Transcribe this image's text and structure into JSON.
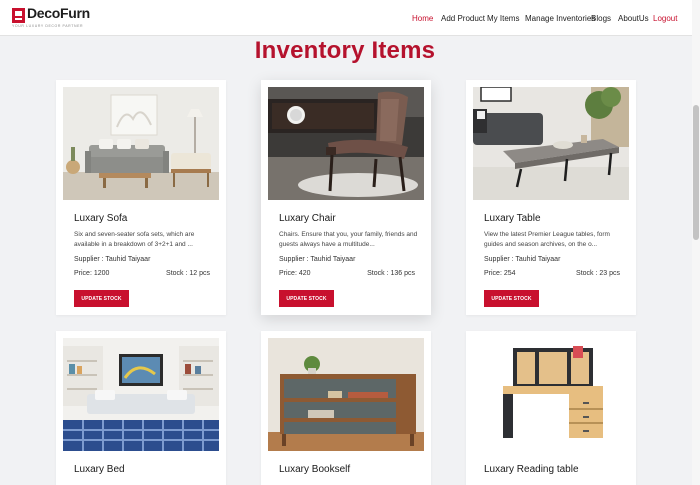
{
  "brand": {
    "name": "DecoFurn",
    "tagline": "YOUR LUXURY DECOR PARTNER"
  },
  "nav": {
    "home": "Home",
    "add_product": "Add Product",
    "my_items": "My Items",
    "manage_inventories": "Manage Inventories",
    "blogs": "Blogs",
    "about": "AboutUs",
    "logout": "Logout"
  },
  "page": {
    "title": "Inventory Items"
  },
  "labels": {
    "update_stock": "UPDATE STOCK"
  },
  "items": [
    {
      "name": "Luxary Sofa",
      "description": "Six and seven-seater sofa sets, which are available in a breakdown of 3+2+1 and ...",
      "supplier": "Supplier : Tauhid Taiyaar",
      "price": "Price: 1200",
      "stock": "Stock : 12 pcs",
      "image": "sofa-photo"
    },
    {
      "name": "Luxary Chair",
      "description": "Chairs. Ensure that you, your family, friends and guests always have a multitude...",
      "supplier": "Supplier : Tauhid Taiyaar",
      "price": "Price: 420",
      "stock": "Stock : 136 pcs",
      "image": "chair-photo"
    },
    {
      "name": "Luxary Table",
      "description": "View the latest Premier League tables, form guides and season archives, on the o...",
      "supplier": "Supplier : Tauhid Taiyaar",
      "price": "Price: 254",
      "stock": "Stock : 23 pcs",
      "image": "table-photo"
    },
    {
      "name": "Luxary Bed",
      "image": "bed-photo"
    },
    {
      "name": "Luxary Bookself",
      "image": "bookshelf-photo"
    },
    {
      "name": "Luxary Reading table",
      "image": "desk-photo"
    }
  ],
  "colors": {
    "accent": "#c8102e",
    "title": "#b5122d",
    "background": "#f1f2f4"
  }
}
